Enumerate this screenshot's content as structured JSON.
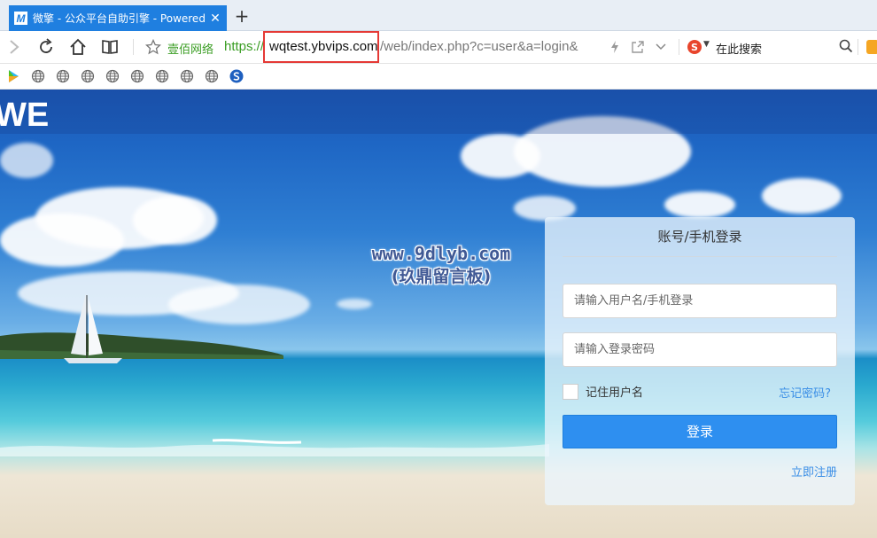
{
  "browser": {
    "tab": {
      "favicon_letter": "M",
      "title": "微擎 - 公众平台自助引擎 - Powered",
      "close": "✕"
    },
    "new_tab": "+",
    "address": {
      "secure_label": "壹佰网络",
      "scheme": "https://",
      "host": "wqtest.ybvips.com",
      "path": "/web/index.php?c=user&a=login&"
    },
    "search": {
      "engine_letter": "S",
      "placeholder": "在此搜索"
    },
    "bookmarks": [
      "play-icon",
      "globe-icon",
      "globe-icon",
      "globe-icon",
      "globe-icon",
      "globe-icon",
      "globe-icon",
      "globe-icon",
      "globe-icon",
      "s-icon"
    ]
  },
  "page": {
    "logo_text": "WE",
    "watermark": {
      "line1": "www.9dlyb.com",
      "line2": "(玖鼎留言板)"
    },
    "login": {
      "title": "账号/手机登录",
      "username_placeholder": "请输入用户名/手机登录",
      "password_placeholder": "请输入登录密码",
      "remember_label": "记住用户名",
      "forgot_label": "忘记密码?",
      "submit_label": "登录",
      "register_label": "立即注册"
    }
  },
  "colors": {
    "tab_active": "#1f7fe0",
    "secure_green": "#3a9d23",
    "highlight_red": "#e53935",
    "primary_button": "#2e8ff0",
    "link_blue": "#3a8ee6"
  }
}
